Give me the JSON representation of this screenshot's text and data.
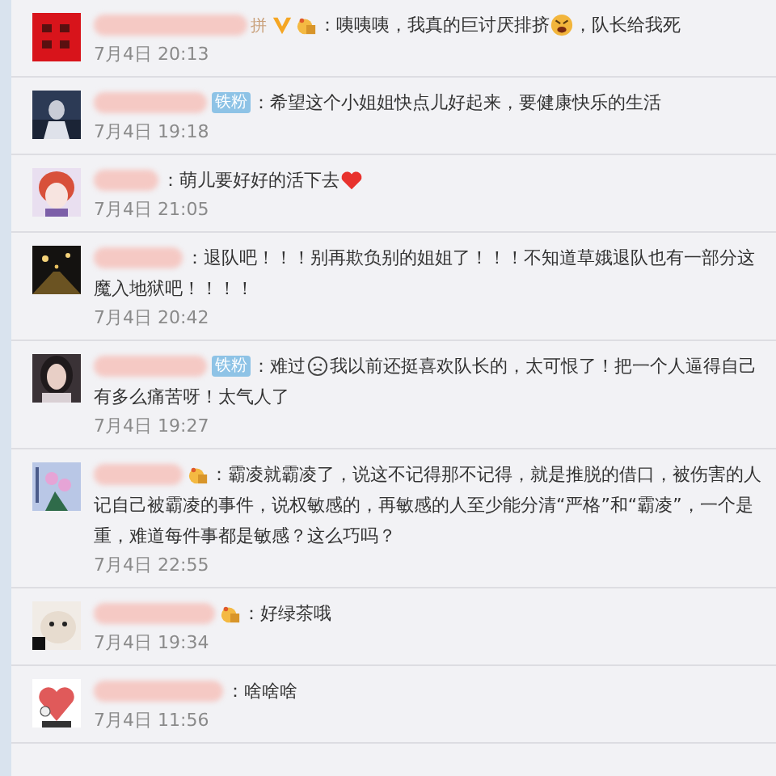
{
  "comments": [
    {
      "name_tail": "拼",
      "badges": [
        {
          "kind": "vip"
        },
        {
          "kind": "medal"
        }
      ],
      "lines": [
        [
          {
            "kind": "text",
            "text": "：咦咦咦，我真的巨讨厌排挤"
          },
          {
            "kind": "angry"
          },
          {
            "kind": "text",
            "text": "，队长给我死"
          }
        ]
      ],
      "date": "7月4日 20:13"
    },
    {
      "badges": [
        {
          "kind": "fan",
          "text": "铁粉"
        }
      ],
      "lines": [
        [
          {
            "kind": "text",
            "text": "：希望这个小姐姐快点儿好起来，要健康快乐的生活"
          }
        ]
      ],
      "date": "7月4日 19:18"
    },
    {
      "lines": [
        [
          {
            "kind": "text",
            "text": "：萌儿要好好的活下去"
          },
          {
            "kind": "heart"
          }
        ]
      ],
      "date": "7月4日 21:05"
    },
    {
      "lines": [
        [
          {
            "kind": "text",
            "text": "：退队吧！！！别再欺负别的姐姐了！！！不知道草娥退队也有一部分这"
          }
        ],
        [
          {
            "kind": "text",
            "text": "魔入地狱吧！！！！"
          }
        ]
      ],
      "date": "7月4日 20:42"
    },
    {
      "badges": [
        {
          "kind": "fan",
          "text": "铁粉"
        }
      ],
      "lines": [
        [
          {
            "kind": "text",
            "text": "：难过"
          },
          {
            "kind": "sad"
          },
          {
            "kind": "text",
            "text": " 我以前还挺喜欢队长的，太可恨了！把一个人逼得自己"
          }
        ],
        [
          {
            "kind": "text",
            "text": "有多么痛苦呀！太气人了"
          }
        ]
      ],
      "date": "7月4日 19:27"
    },
    {
      "badges": [
        {
          "kind": "medal"
        }
      ],
      "lines": [
        [
          {
            "kind": "text",
            "text": "：霸凌就霸凌了，说这不记得那不记得，就是推脱的借口，被伤害的人"
          }
        ],
        [
          {
            "kind": "text",
            "text": "记自己被霸凌的事件，说权敏感的，再敏感的人至少能分清“严格”和“霸凌”，一个是"
          }
        ],
        [
          {
            "kind": "text",
            "text": "重，难道每件事都是敏感？这么巧吗？"
          }
        ]
      ],
      "date": "7月4日 22:55"
    },
    {
      "badges": [
        {
          "kind": "medal"
        }
      ],
      "lines": [
        [
          {
            "kind": "text",
            "text": "：好绿茶哦"
          }
        ]
      ],
      "date": "7月4日 19:34"
    },
    {
      "lines": [
        [
          {
            "kind": "text",
            "text": "：啥啥啥"
          }
        ]
      ],
      "date": "7月4日 11:56"
    }
  ]
}
